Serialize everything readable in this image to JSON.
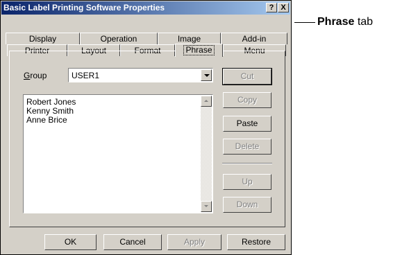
{
  "window": {
    "title": "Basic Label Printing Software Properties",
    "help_btn": "?",
    "close_btn": "X"
  },
  "tabs_row1": [
    "Display",
    "Operation",
    "Image",
    "Add-in"
  ],
  "tabs_row2": [
    "Printer",
    "Layout",
    "Format",
    "Phrase",
    "Menu"
  ],
  "selected_tab": "Phrase",
  "group": {
    "label_mnemonic": "G",
    "label_rest": "roup",
    "value": "USER1"
  },
  "phrases": [
    "Robert Jones",
    "Kenny Smith",
    "Anne Brice"
  ],
  "side_buttons": {
    "cut": "Cut",
    "copy": "Copy",
    "paste": "Paste",
    "delete": "Delete",
    "up": "Up",
    "down": "Down"
  },
  "bottom_buttons": {
    "ok": "OK",
    "cancel": "Cancel",
    "apply": "Apply",
    "restore": "Restore"
  },
  "callout": {
    "bold": "Phrase",
    "rest": " tab"
  }
}
